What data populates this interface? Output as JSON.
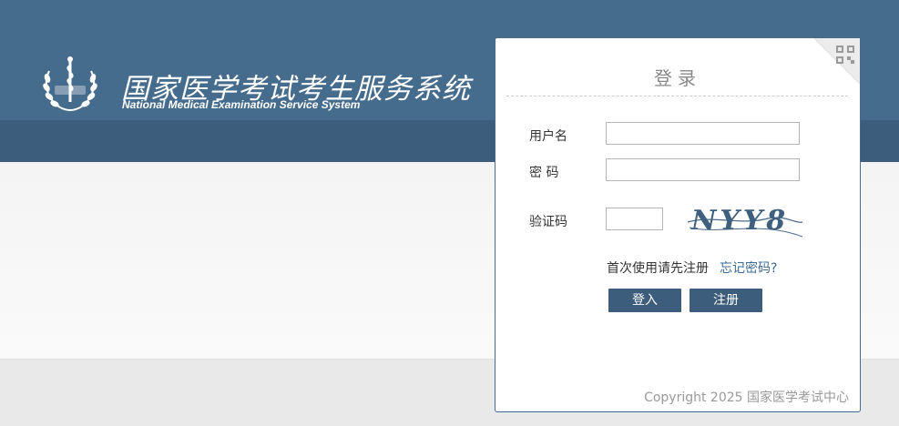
{
  "header": {
    "site_title": "国家医学考试考生服务系统",
    "site_subtitle": "National Medical Examination Service System"
  },
  "login": {
    "title": "登录",
    "username_label": "用户名",
    "password_label": "密 码",
    "captcha_label": "验证码",
    "username_value": "",
    "password_value": "",
    "captcha_value": "",
    "captcha_text": "NYY8",
    "first_use_link": "首次使用请先注册",
    "forgot_link": "忘记密码?",
    "login_button": "登入",
    "register_button": "注册",
    "copyright": "Copyright 2025 国家医学考试中心"
  },
  "colors": {
    "header_top": "#466c8d",
    "header_bottom": "#3c5e7c",
    "button": "#3c5e7c",
    "link": "#3b6a93"
  }
}
